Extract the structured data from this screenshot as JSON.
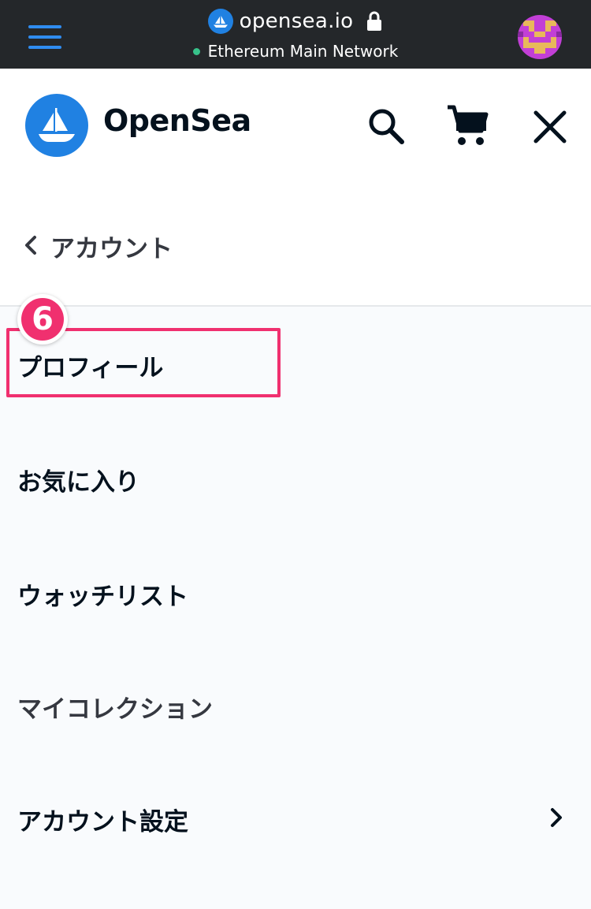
{
  "browser_bar": {
    "url": "opensea.io",
    "network": "Ethereum Main Network",
    "network_status_color": "#37c28a",
    "accent_color": "#2f8cf0",
    "icons": [
      "menu-icon",
      "opensea-favicon-icon",
      "lock-icon",
      "account-avatar"
    ]
  },
  "header": {
    "brand": "OpenSea",
    "brand_color": "#2081e2",
    "icons": [
      "search-icon",
      "cart-icon",
      "close-icon"
    ]
  },
  "nav": {
    "back_label": "アカウント"
  },
  "menu": {
    "items": [
      {
        "label": "プロフィール",
        "highlighted": true
      },
      {
        "label": "お気に入り"
      },
      {
        "label": "ウォッチリスト"
      },
      {
        "label": "マイコレクション"
      },
      {
        "label": "アカウント設定",
        "has_submenu": true
      }
    ]
  },
  "annotation": {
    "step_number": "6",
    "highlight_color": "#f0306f"
  }
}
